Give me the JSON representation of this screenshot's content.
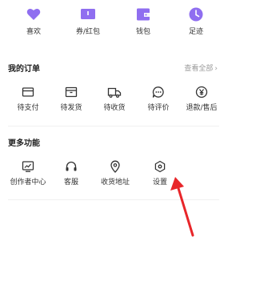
{
  "colors": {
    "accent_purple": "#8f6ef0",
    "icon_gray": "#333333",
    "arrow_red": "#e8262a",
    "muted_text": "#9a9a9a"
  },
  "quick_links": [
    {
      "label": "喜欢",
      "icon": "heart-icon"
    },
    {
      "label": "券/红包",
      "icon": "ticket-icon"
    },
    {
      "label": "钱包",
      "icon": "wallet-icon"
    },
    {
      "label": "足迹",
      "icon": "clock-icon"
    }
  ],
  "orders": {
    "title": "我的订单",
    "view_all": "查看全部",
    "items": [
      {
        "label": "待支付",
        "icon": "card-icon"
      },
      {
        "label": "待发货",
        "icon": "box-icon"
      },
      {
        "label": "待收货",
        "icon": "truck-icon"
      },
      {
        "label": "待评价",
        "icon": "chat-bubble-icon"
      },
      {
        "label": "退款/售后",
        "icon": "yen-icon"
      }
    ]
  },
  "more": {
    "title": "更多功能",
    "items": [
      {
        "label": "创作者中心",
        "icon": "chart-board-icon"
      },
      {
        "label": "客服",
        "icon": "headset-icon"
      },
      {
        "label": "收货地址",
        "icon": "location-pin-icon"
      },
      {
        "label": "设置",
        "icon": "gear-hexagon-icon"
      }
    ]
  },
  "annotation": {
    "icon": "red-arrow-icon"
  }
}
